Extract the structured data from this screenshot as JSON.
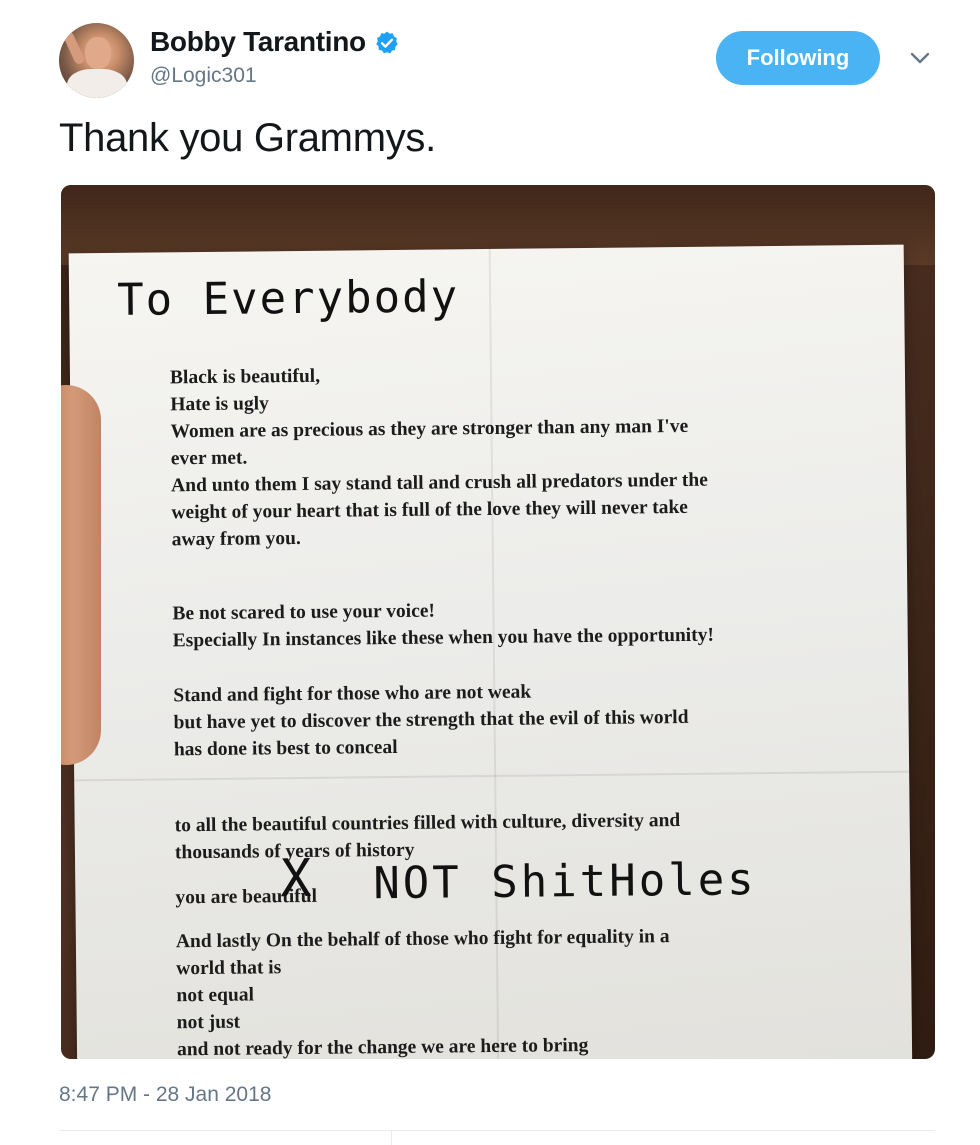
{
  "user": {
    "display_name": "Bobby Tarantino",
    "handle": "@Logic301",
    "verified_icon": "verified-badge-icon"
  },
  "actions": {
    "follow_label": "Following",
    "menu_icon": "chevron-down-icon"
  },
  "colors": {
    "accent": "#4ab3f4",
    "verified": "#1da1f2",
    "secondary_text": "#657786"
  },
  "tweet": {
    "text": "Thank you Grammys.",
    "timestamp": "8:47 PM - 28 Jan 2018"
  },
  "photo": {
    "handwritten_heading": "To Everybody",
    "handwritten_insert": "NOT ShitHoles",
    "handwritten_strike": "X",
    "letter_block_1": "Black is beautiful,\nHate is ugly\nWomen are as precious as they are stronger than any man I've\never met.\nAnd unto them I say stand tall and crush all predators under the\nweight of your heart that is full of the love they will never take\naway from you.",
    "letter_block_2": "Be not scared to use your voice!\nEspecially In instances like these when you have the opportunity!",
    "letter_block_3": "Stand and fight for those who are not weak\nbut have yet to discover the strength that the evil of this world\nhas done its best to conceal",
    "letter_block_4": "to all the beautiful countries filled with culture, diversity and\nthousands of years of history",
    "letter_block_5": "you are beautiful",
    "letter_block_6": "And lastly On the behalf of those who fight for equality in a\nworld that is\nnot equal\nnot just\nand not ready for the change we are here to bring"
  }
}
